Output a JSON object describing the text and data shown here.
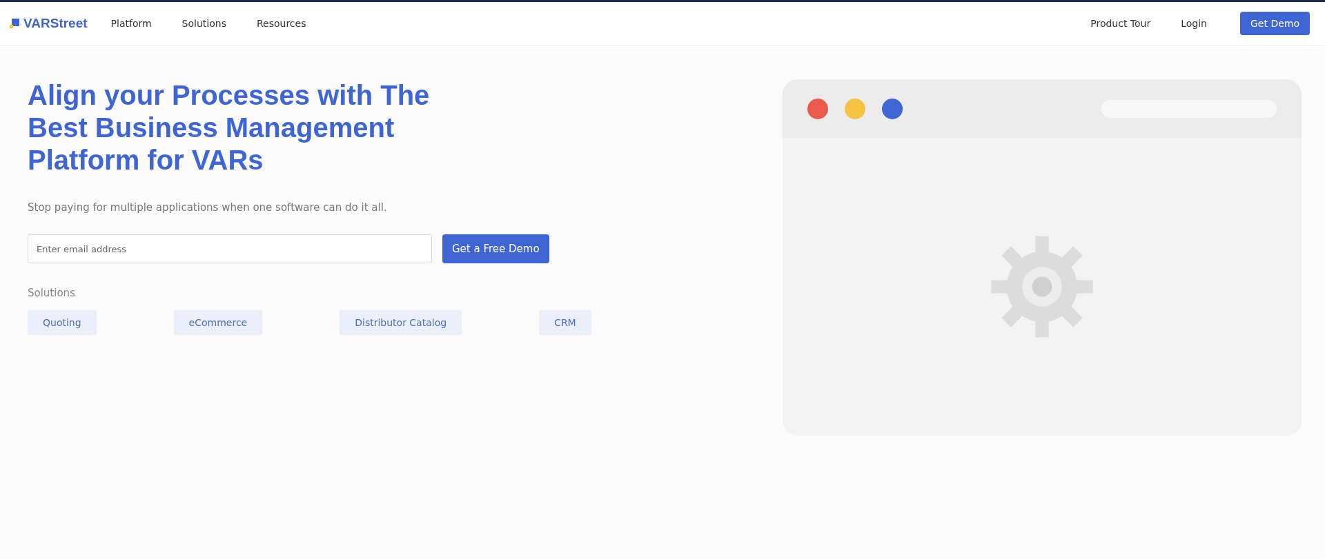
{
  "header": {
    "logo": "VARStreet",
    "nav": [
      "Platform",
      "Solutions",
      "Resources"
    ],
    "right_links": [
      "Product Tour",
      "Login"
    ],
    "cta": "Get Demo"
  },
  "hero": {
    "title": "Align your Processes with The Best Business Management Platform for VARs",
    "subtitle": "Stop paying for multiple applications when one software can do it all.",
    "email": {
      "placeholder": "Enter email address"
    },
    "button": "Get a Free Demo",
    "solutions_label": "Solutions",
    "solutions": [
      "Quoting",
      "eCommerce",
      "Distributor Catalog",
      "CRM"
    ]
  },
  "illustration": {
    "window_dots": [
      {
        "color": "#ea5b4b"
      },
      {
        "color": "#f5c342"
      },
      {
        "color": "#3f65d4"
      }
    ]
  }
}
